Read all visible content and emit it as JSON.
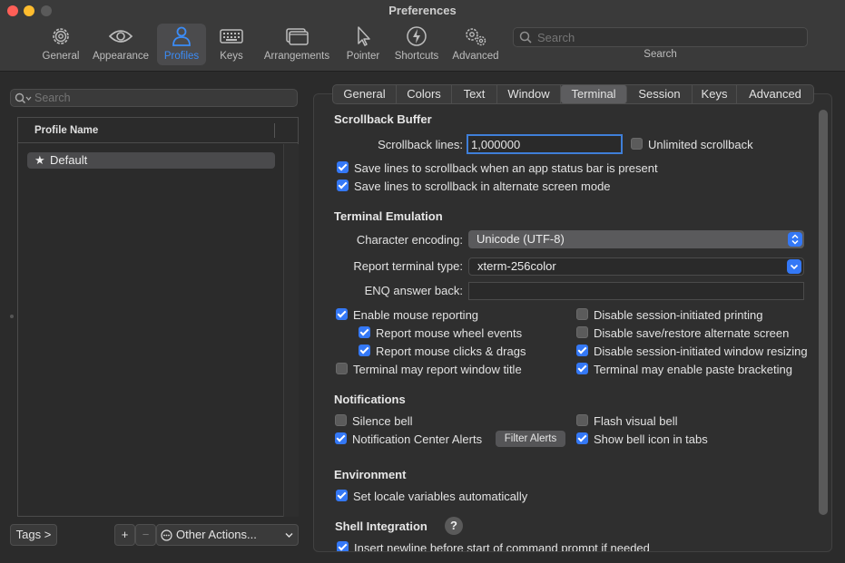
{
  "window": {
    "title": "Preferences"
  },
  "toolbar": {
    "items": [
      {
        "label": "General",
        "icon": "gear-icon"
      },
      {
        "label": "Appearance",
        "icon": "eye-icon"
      },
      {
        "label": "Profiles",
        "icon": "person-icon",
        "active": true
      },
      {
        "label": "Keys",
        "icon": "keyboard-icon"
      },
      {
        "label": "Arrangements",
        "icon": "windows-icon"
      },
      {
        "label": "Pointer",
        "icon": "pointer-icon"
      },
      {
        "label": "Shortcuts",
        "icon": "lightning-icon"
      },
      {
        "label": "Advanced",
        "icon": "gears-icon"
      }
    ],
    "search": {
      "placeholder": "Search",
      "label": "Search"
    }
  },
  "profiles": {
    "search_placeholder": "Search",
    "column_header": "Profile Name",
    "items": [
      {
        "name": "Default",
        "default": true
      }
    ],
    "tags_button": "Tags >",
    "add_label": "+",
    "remove_label": "−",
    "other_actions": "Other Actions..."
  },
  "tabs": [
    {
      "label": "General"
    },
    {
      "label": "Colors"
    },
    {
      "label": "Text"
    },
    {
      "label": "Window"
    },
    {
      "label": "Terminal",
      "active": true
    },
    {
      "label": "Session"
    },
    {
      "label": "Keys"
    },
    {
      "label": "Advanced"
    }
  ],
  "scrollback": {
    "title": "Scrollback Buffer",
    "lines_label": "Scrollback lines:",
    "lines_value": "1,000000",
    "unlimited_label": "Unlimited scrollback",
    "unlimited_checked": false,
    "save_status_label": "Save lines to scrollback when an app status bar is present",
    "save_status_checked": true,
    "save_alt_label": "Save lines to scrollback in alternate screen mode",
    "save_alt_checked": true
  },
  "emulation": {
    "title": "Terminal Emulation",
    "encoding_label": "Character encoding:",
    "encoding_value": "Unicode (UTF-8)",
    "report_type_label": "Report terminal type:",
    "report_type_value": "xterm-256color",
    "enq_label": "ENQ answer back:",
    "enq_value": "",
    "left_options": [
      {
        "label": "Enable mouse reporting",
        "checked": true
      },
      {
        "label": "Report mouse wheel events",
        "checked": true
      },
      {
        "label": "Report mouse clicks & drags",
        "checked": true
      },
      {
        "label": "Terminal may report window title",
        "checked": false
      }
    ],
    "right_options": [
      {
        "label": "Disable session-initiated printing",
        "checked": false
      },
      {
        "label": "Disable save/restore alternate screen",
        "checked": false
      },
      {
        "label": "Disable session-initiated window resizing",
        "checked": true
      },
      {
        "label": "Terminal may enable paste bracketing",
        "checked": true
      }
    ]
  },
  "notifications": {
    "title": "Notifications",
    "silence_bell": {
      "label": "Silence bell",
      "checked": false
    },
    "flash_bell": {
      "label": "Flash visual bell",
      "checked": false
    },
    "notification_center": {
      "label": "Notification Center Alerts",
      "checked": true
    },
    "filter_alerts": "Filter Alerts",
    "bell_icon_tabs": {
      "label": "Show bell icon in tabs",
      "checked": true
    }
  },
  "environment": {
    "title": "Environment",
    "locale": {
      "label": "Set locale variables automatically",
      "checked": true
    }
  },
  "shell_integration": {
    "title": "Shell Integration",
    "help": "?",
    "newline": {
      "label": "Insert newline before start of command prompt if needed",
      "checked": true
    }
  }
}
